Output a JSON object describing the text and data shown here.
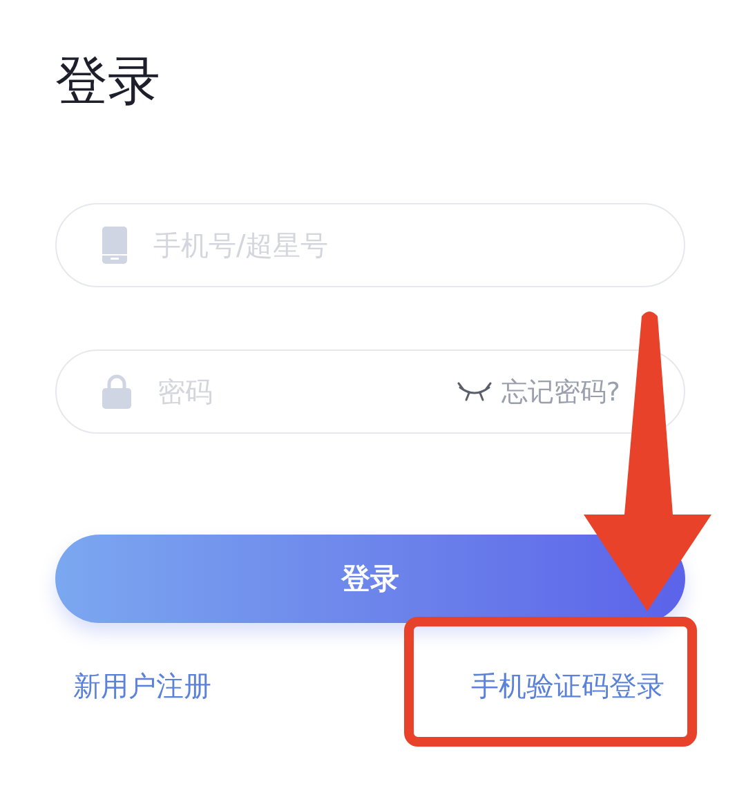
{
  "title": "登录",
  "fields": [
    {
      "kind": "phone",
      "placeholder": "手机号/超星号"
    },
    {
      "kind": "password",
      "placeholder": "密码",
      "action": "忘记密码?"
    }
  ],
  "login_button": "登录",
  "links": [
    "新用户注册",
    "手机验证码登录"
  ]
}
